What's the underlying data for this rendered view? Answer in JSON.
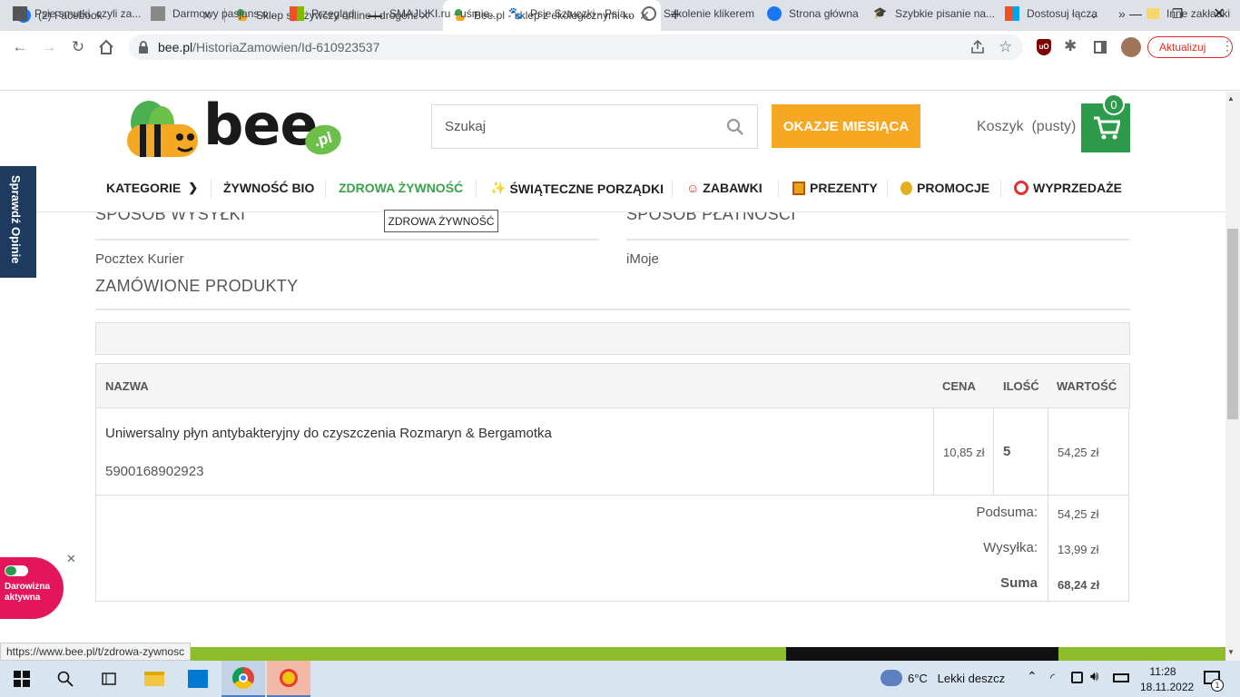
{
  "browser": {
    "tabs": [
      {
        "title": "(2) Facebook",
        "active": false
      },
      {
        "title": "Sklep spożywczy online i drogeria",
        "active": false
      },
      {
        "title": "Bee.pl - sklep z ekologicznymi ko",
        "active": true
      }
    ],
    "new_tab": "+",
    "url_domain": "bee.pl",
    "url_path": "/HistoriaZamowien/Id-610923537",
    "update_label": "Aktualizuj",
    "bookmarks": [
      "Psie smutki, czyli za...",
      "Darmowy pasjans o...",
      "Przegląd",
      "SMAJLIKI.ru - uśmie...",
      "Psie Sztuczki - Psia...",
      "Szkolenie klikerem",
      "Strona główna",
      "Szybkie pisanie na...",
      "Dostosuj łącza"
    ],
    "bookmarks_more": "»",
    "other_bookmarks": "Inne zakładki",
    "status_url": "https://www.bee.pl/t/zdrowa-zywnosc"
  },
  "site": {
    "logo_text": "bee",
    "logo_badge": ".pl",
    "search_placeholder": "Szukaj",
    "promo_button": "OKAZJE MIESIĄCA",
    "cart_label": "Koszyk",
    "cart_status": "(pusty)",
    "cart_count": "0",
    "nav": [
      {
        "label": "KATEGORIE"
      },
      {
        "label": "ŻYWNOŚĆ BIO"
      },
      {
        "label": "ZDROWA ŻYWNOŚĆ"
      },
      {
        "label": "ŚWIĄTECZNE PORZĄDKI"
      },
      {
        "label": "ZABAWKI"
      },
      {
        "label": "PREZENTY"
      },
      {
        "label": "PROMOCJE"
      },
      {
        "label": "WYPRZEDAŻE"
      }
    ],
    "tooltip": "ZDROWA ŻYWNOŚĆ",
    "side_tab": "Sprawdź Opinie",
    "donation_label": "Darowizna aktywna"
  },
  "order": {
    "shipping_heading": "SPOSÓB WYSYŁKI",
    "shipping_value": "Pocztex Kurier",
    "payment_heading": "SPOSÓB PŁATNOŚCI",
    "payment_value": "iMoje",
    "products_heading": "ZAMÓWIONE PRODUKTY",
    "columns": {
      "name": "NAZWA",
      "price": "CENA",
      "qty": "ILOŚĆ",
      "value": "WARTOŚĆ"
    },
    "items": [
      {
        "name": "Uniwersalny płyn antybakteryjny do czyszczenia Rozmaryn & Bergamotka",
        "ean": "5900168902923",
        "price": "10,85 zł",
        "qty": "5",
        "value": "54,25 zł"
      }
    ],
    "subtotal_label": "Podsuma:",
    "subtotal": "54,25 zł",
    "shipping_cost_label": "Wysyłka:",
    "shipping_cost": "13,99 zł",
    "total_label": "Suma",
    "total": "68,24 zł"
  },
  "taskbar": {
    "temperature": "6°C",
    "weather": "Lekki deszcz",
    "time": "11:28",
    "date": "18.11.2022",
    "notifications": "1"
  },
  "colors": {
    "brand_green": "#2e9b4c",
    "nav_green": "#3aa34a",
    "promo_orange": "#f7a823",
    "donation_pink": "#e3165b",
    "side_tab_navy": "#1e3a5f"
  }
}
